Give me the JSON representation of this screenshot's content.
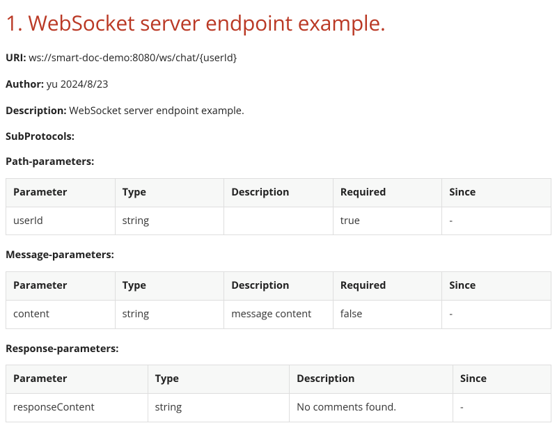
{
  "title": "1. WebSocket server endpoint example.",
  "uri": {
    "label": "URI:",
    "value": "ws://smart-doc-demo:8080/ws/chat/{userId}"
  },
  "author": {
    "label": "Author:",
    "value": "yu 2024/8/23"
  },
  "description": {
    "label": "Description:",
    "value": "WebSocket server endpoint example."
  },
  "subprotocols": {
    "label": "SubProtocols:"
  },
  "path_params": {
    "label": "Path-parameters:",
    "headers": {
      "parameter": "Parameter",
      "type": "Type",
      "description": "Description",
      "required": "Required",
      "since": "Since"
    },
    "rows": [
      {
        "parameter": "userId",
        "type": "string",
        "description": "",
        "required": "true",
        "since": "-"
      }
    ]
  },
  "message_params": {
    "label": "Message-parameters:",
    "headers": {
      "parameter": "Parameter",
      "type": "Type",
      "description": "Description",
      "required": "Required",
      "since": "Since"
    },
    "rows": [
      {
        "parameter": "content",
        "type": "string",
        "description": "message content",
        "required": "false",
        "since": "-"
      }
    ]
  },
  "response_params": {
    "label": "Response-parameters:",
    "headers": {
      "parameter": "Parameter",
      "type": "Type",
      "description": "Description",
      "since": "Since"
    },
    "rows": [
      {
        "parameter": "responseContent",
        "type": "string",
        "description": "No comments found.",
        "since": "-"
      }
    ]
  }
}
